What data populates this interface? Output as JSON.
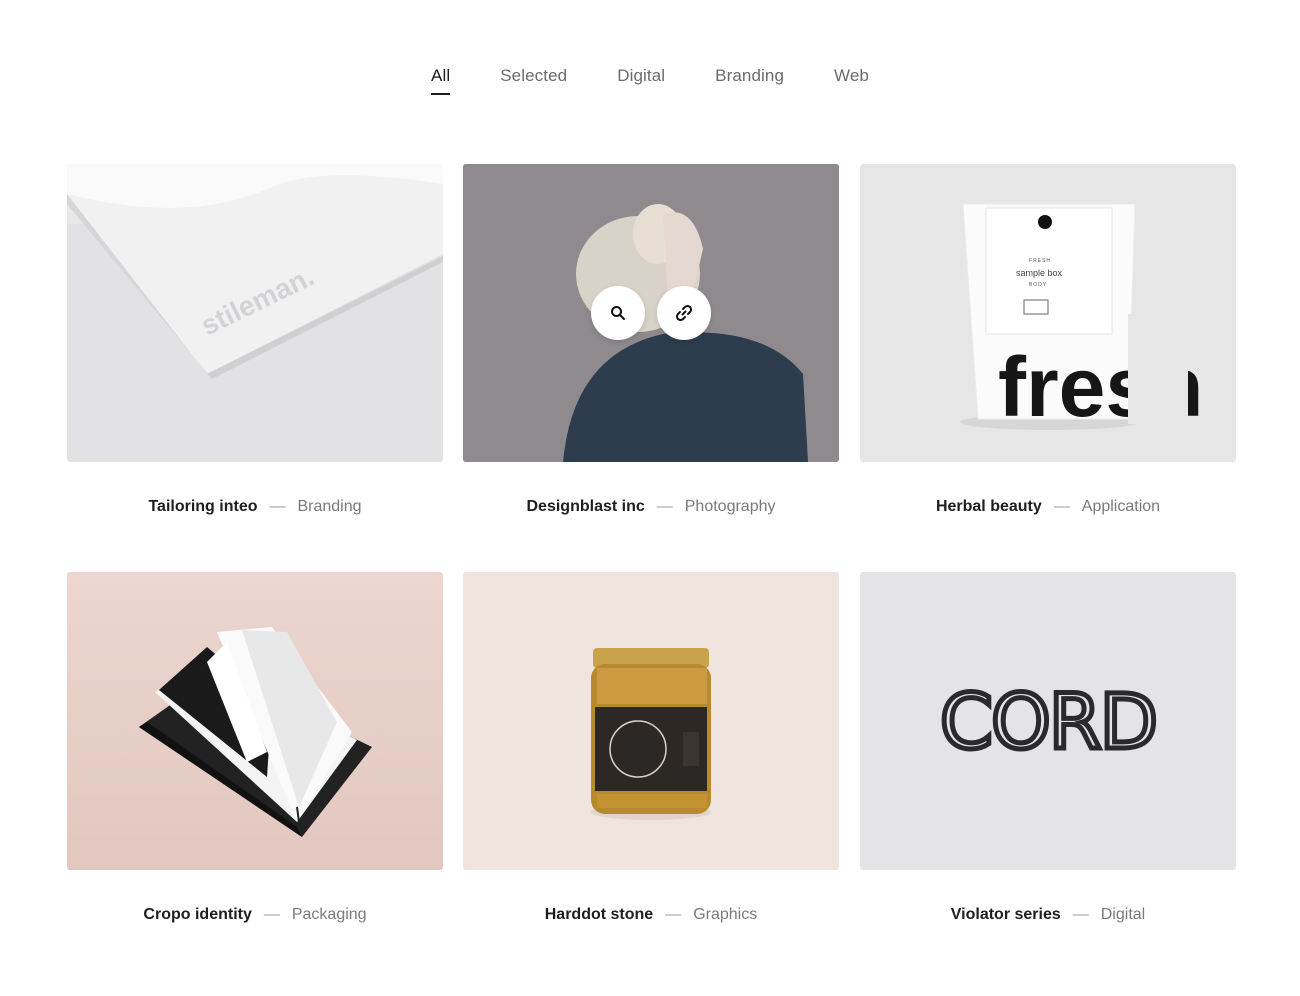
{
  "filters": [
    {
      "label": "All",
      "active": true
    },
    {
      "label": "Selected"
    },
    {
      "label": "Digital"
    },
    {
      "label": "Branding"
    },
    {
      "label": "Web"
    }
  ],
  "projects": [
    {
      "title": "Tailoring inteo",
      "category": "Branding",
      "brand_text": "stileman."
    },
    {
      "title": "Designblast inc",
      "category": "Photography"
    },
    {
      "title": "Herbal beauty",
      "category": "Application",
      "box_small": "FRESH",
      "box_text": "sample box",
      "box_small2": "BODY",
      "box_big": "fresh"
    },
    {
      "title": "Cropo identity",
      "category": "Packaging"
    },
    {
      "title": "Harddot stone",
      "category": "Graphics"
    },
    {
      "title": "Violator series",
      "category": "Digital",
      "logo_text": "CORD"
    }
  ],
  "dash": "—",
  "icons": [
    "search-icon",
    "link-icon"
  ]
}
